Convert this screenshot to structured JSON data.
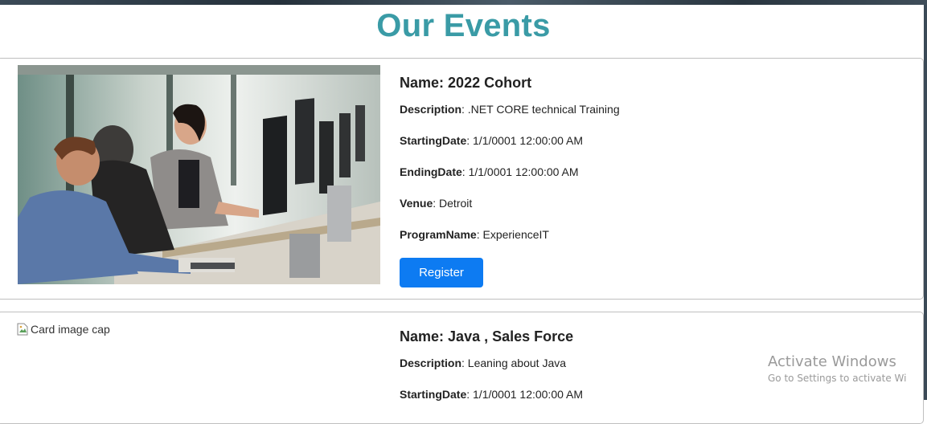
{
  "page": {
    "title": "Our Events"
  },
  "events": [
    {
      "name_label": "Name:",
      "name": "2022 Cohort",
      "description_label": "Description",
      "description": ".NET CORE technical Training",
      "starting_label": "StartingDate",
      "starting": "1/1/0001 12:00:00 AM",
      "ending_label": "EndingDate",
      "ending": "1/1/0001 12:00:00 AM",
      "venue_label": "Venue",
      "venue": "Detroit",
      "program_label": "ProgramName",
      "program": "ExperienceIT",
      "register_label": "Register"
    },
    {
      "image_alt": "Card image cap",
      "name_label": "Name:",
      "name": "Java , Sales Force",
      "description_label": "Description",
      "description": "Leaning about Java",
      "starting_label": "StartingDate",
      "starting": "1/1/0001 12:00:00 AM"
    }
  ],
  "watermark": {
    "title": "Activate Windows",
    "subtitle": "Go to Settings to activate Wi"
  },
  "colors": {
    "title": "#3a9ba6",
    "button": "#0d7bf2"
  }
}
